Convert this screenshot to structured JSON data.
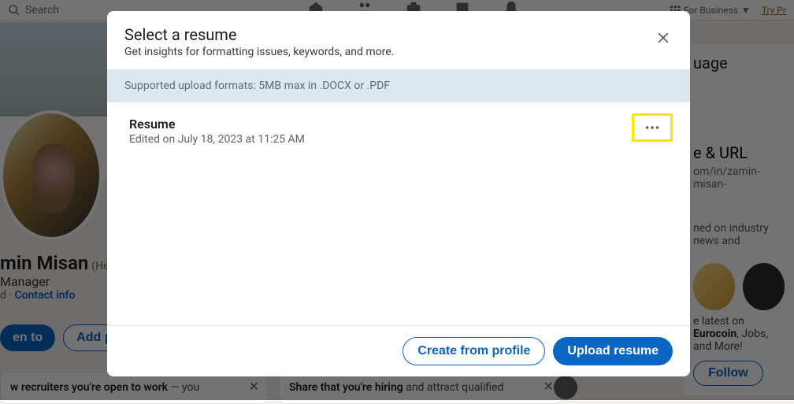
{
  "header": {
    "search_placeholder": "Search",
    "for_business": "For Business",
    "try_premium": "Try Pr"
  },
  "profile": {
    "name_partial": "min Misan",
    "pronoun": "(He",
    "title_partial": " Manager",
    "location_partial": "d · ",
    "contact_info": "Contact info",
    "open_to": "en to",
    "add_profile": "Add pr"
  },
  "cards": {
    "recruiters_bold": "w recruiters you're open to work",
    "recruiters_rest": " — you",
    "hiring_bold": "Share that you're hiring",
    "hiring_rest": " and attract qualified"
  },
  "right": {
    "heading_partial": "uage",
    "profile_url_heading": "e & URL",
    "url_partial": "om/in/zamin-misan-",
    "news_partial": "ned on industry news and",
    "eurocoin_pre": "e latest on ",
    "eurocoin_bold": "Eurocoin",
    "eurocoin_post": ", Jobs, and More!",
    "follow": "Follow"
  },
  "modal": {
    "title": "Select a resume",
    "subtitle": "Get insights for formatting issues, keywords, and more.",
    "format_note": "Supported upload formats: 5MB max in .DOCX or .PDF",
    "resume_name": "Resume",
    "resume_edited": "Edited on July 18, 2023 at 11:25 AM",
    "create_from_profile": "Create from profile",
    "upload_resume": "Upload resume"
  }
}
